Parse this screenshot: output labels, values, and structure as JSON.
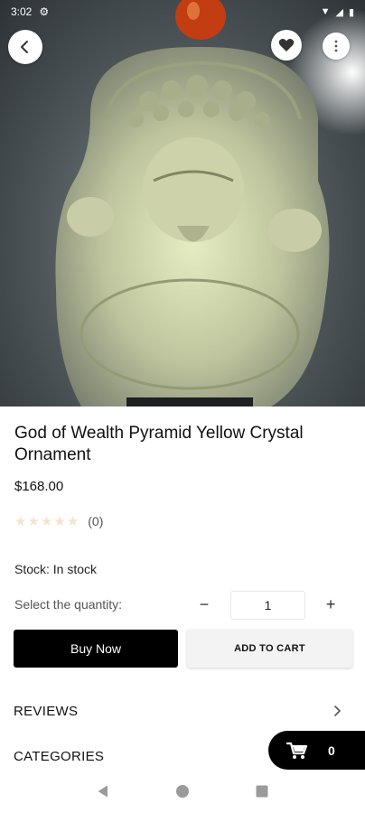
{
  "status_bar": {
    "time": "3:02"
  },
  "product": {
    "title": "God of Wealth Pyramid Yellow Crystal Ornament",
    "price": "$168.00",
    "rating": 0,
    "review_count": "(0)",
    "stock_label": "Stock:",
    "stock_value": "In stock",
    "quantity_label": "Select the quantity:",
    "quantity": "1"
  },
  "buttons": {
    "buy_now": "Buy Now",
    "add_to_cart": "ADD TO CART"
  },
  "sections": {
    "reviews": "REVIEWS",
    "categories": "CATEGORIES"
  },
  "cart": {
    "count": "0"
  },
  "controls": {
    "minus": "−",
    "plus": "+"
  },
  "icons": {
    "back": "chevron-left-icon",
    "favorite": "heart-icon",
    "menu": "more-vertical-icon",
    "cart": "shopping-cart-icon",
    "chevron": "chevron-right-icon",
    "nav_back": "triangle-back-icon",
    "nav_home": "circle-home-icon",
    "nav_recents": "square-recents-icon"
  },
  "colors": {
    "primary": "#000000",
    "star_empty": "#f4e4cf",
    "secondary_button": "#f3f3f3"
  }
}
